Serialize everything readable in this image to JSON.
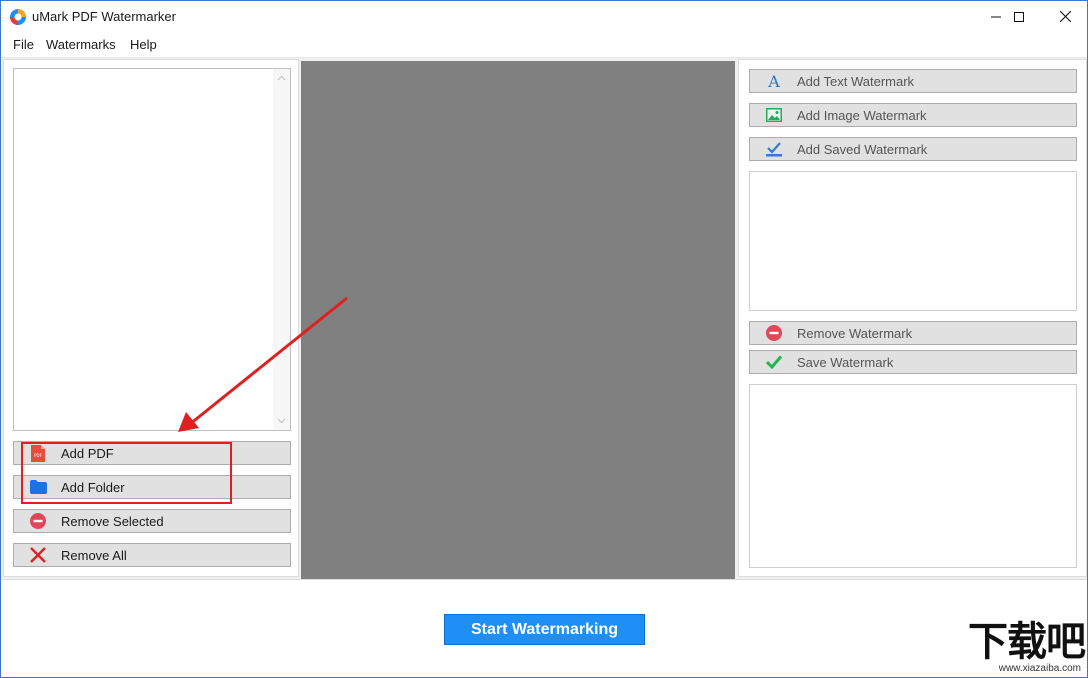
{
  "window": {
    "title": "uMark PDF Watermarker"
  },
  "menu": {
    "items": [
      "File",
      "Watermarks",
      "Help"
    ]
  },
  "left_panel": {
    "buttons": [
      {
        "label": "Add PDF",
        "icon": "pdf-file-icon"
      },
      {
        "label": "Add Folder",
        "icon": "folder-icon"
      },
      {
        "label": "Remove Selected",
        "icon": "minus-circle-icon"
      },
      {
        "label": "Remove All",
        "icon": "red-x-icon"
      }
    ]
  },
  "right_panel": {
    "top_buttons": [
      {
        "label": "Add Text Watermark",
        "icon": "text-a-icon"
      },
      {
        "label": "Add Image Watermark",
        "icon": "image-icon"
      },
      {
        "label": "Add Saved Watermark",
        "icon": "download-check-icon"
      }
    ],
    "bottom_buttons": [
      {
        "label": "Remove Watermark",
        "icon": "minus-circle-icon"
      },
      {
        "label": "Save Watermark",
        "icon": "green-check-icon"
      }
    ]
  },
  "bottom": {
    "start_label": "Start Watermarking"
  },
  "site_watermark": {
    "logo": "下载吧",
    "url": "www.xiazaiba.com"
  },
  "colors": {
    "accent": "#1e90f5",
    "annotation": "#e02020",
    "preview_bg": "#808080"
  }
}
